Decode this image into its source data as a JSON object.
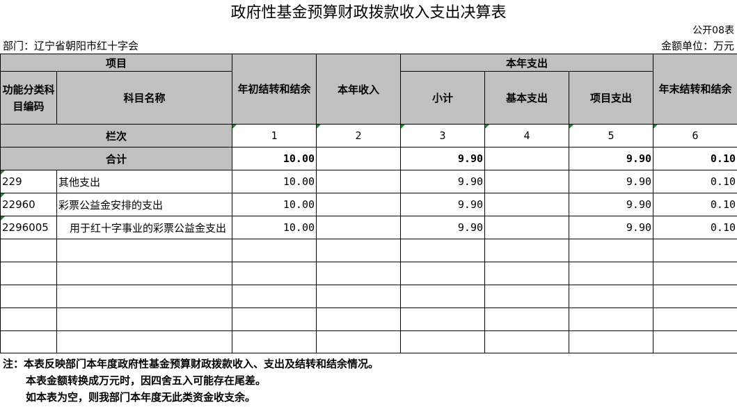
{
  "title": "政府性基金预算财政拨款收入支出决算表",
  "form_code": "公开08表",
  "department": "部门：辽宁省朝阳市红十字会",
  "unit": "金额单位：万元",
  "headers": {
    "item": "项目",
    "func_code": "功能分类科目编码",
    "subject_name": "科目名称",
    "begin_balance": "年初结转和结余",
    "income": "本年收入",
    "expense": "本年支出",
    "subtotal": "小计",
    "basic": "基本支出",
    "project": "项目支出",
    "end_balance": "年末结转和结余",
    "column_index_label": "栏次",
    "idx1": "1",
    "idx2": "2",
    "idx3": "3",
    "idx4": "4",
    "idx5": "5",
    "idx6": "6"
  },
  "total": {
    "label": "合计",
    "begin": "10.00",
    "income": "",
    "subtotal": "9.90",
    "basic": "",
    "project": "9.90",
    "end": "0.10"
  },
  "rows": [
    {
      "code": "229",
      "name": "其他支出",
      "begin": "10.00",
      "income": "",
      "subtotal": "9.90",
      "basic": "",
      "project": "9.90",
      "end": "0.10"
    },
    {
      "code": "22960",
      "name": "彩票公益金安排的支出",
      "begin": "10.00",
      "income": "",
      "subtotal": "9.90",
      "basic": "",
      "project": "9.90",
      "end": "0.10"
    },
    {
      "code": "2296005",
      "name": "用于红十字事业的彩票公益金支出",
      "begin": "10.00",
      "income": "",
      "subtotal": "9.90",
      "basic": "",
      "project": "9.90",
      "end": "0.10"
    }
  ],
  "notes": {
    "line1": "注：本表反映部门本年度政府性基金预算财政拨款收入、支出及结转和结余情况。",
    "line2": "本表金额转换成万元时，因四舍五入可能存在尾差。",
    "line3": "如本表为空，则我部门本年度无此类资金收支余。"
  }
}
